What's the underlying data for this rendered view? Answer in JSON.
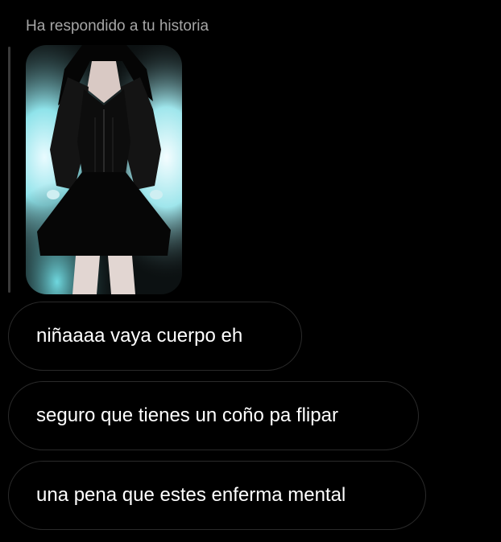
{
  "reply_header": {
    "text": "Ha respondido a tu historia"
  },
  "story": {
    "icon": "story-thumbnail-image",
    "accent_color": "#8fe3ea"
  },
  "messages": [
    {
      "text": "niñaaaa vaya cuerpo eh"
    },
    {
      "text": "seguro que tienes un coño pa flipar"
    },
    {
      "text": "una pena que estes enferma mental"
    }
  ],
  "colors": {
    "background": "#000000",
    "bubble_border": "#2a2a2a",
    "header_text": "#a6a6a6",
    "message_text": "#ffffff"
  }
}
